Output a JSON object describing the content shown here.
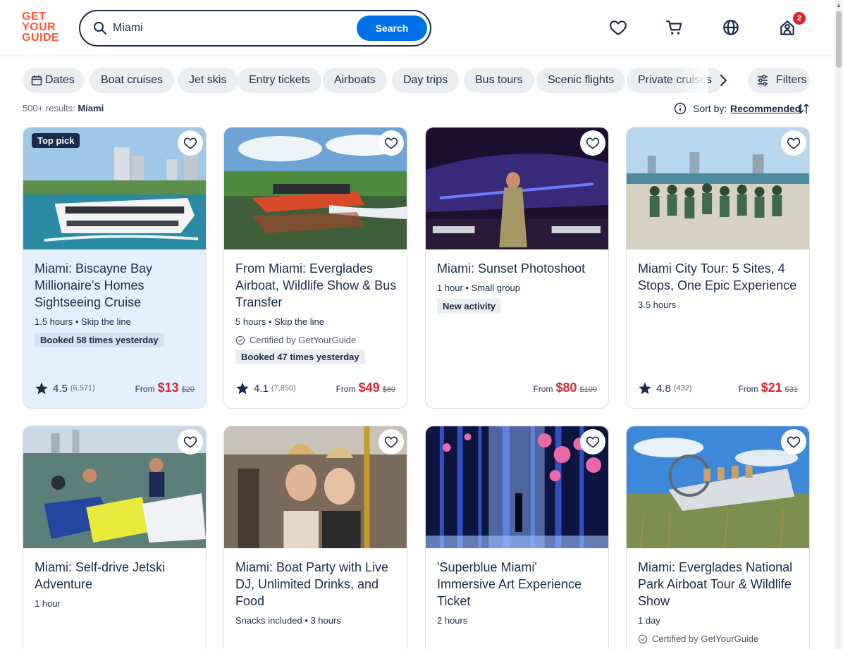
{
  "header": {
    "logo": [
      "GET",
      "YOUR",
      "GUIDE"
    ],
    "search_value": "Miami",
    "search_button": "Search",
    "cart_badge": "2",
    "icons": [
      "heart-icon",
      "cart-icon",
      "globe-icon",
      "profile-icon"
    ]
  },
  "filters": {
    "dates": "Dates",
    "chips": [
      "Boat cruises",
      "Jet skis",
      "Entry tickets",
      "Airboats",
      "Day trips",
      "Bus tours",
      "Scenic flights",
      "Private cruises"
    ],
    "filters_label": "Filters"
  },
  "results": {
    "count": "500+ results:",
    "query": "Miami",
    "sort_label": "Sort by:",
    "sort_value": "Recommended"
  },
  "cards": [
    {
      "badge": "Top pick",
      "title": "Miami: Biscayne Bay Millionaire's Homes Sightseeing Cruise",
      "meta": "1.5 hours • Skip the line",
      "tag": "Booked 58 times yesterday",
      "rating": "4.5",
      "reviews": "(6,571)",
      "from": "From",
      "price": "$13",
      "old_price": "$20"
    },
    {
      "title": "From Miami: Everglades Airboat, Wildlife Show & Bus Transfer",
      "meta": "5 hours • Skip the line",
      "certified": "Certified by GetYourGuide",
      "tag": "Booked 47 times yesterday",
      "rating": "4.1",
      "reviews": "(7,850)",
      "from": "From",
      "price": "$49",
      "old_price": "$60"
    },
    {
      "title": "Miami: Sunset Photoshoot",
      "meta": "1 hour • Small group",
      "tag": "New activity",
      "from": "From",
      "price": "$80",
      "old_price": "$100"
    },
    {
      "title": "Miami City Tour: 5 Sites, 4 Stops, One Epic Experience",
      "meta": "3.5 hours",
      "rating": "4.8",
      "reviews": "(432)",
      "from": "From",
      "price": "$21",
      "old_price": "$31"
    },
    {
      "title": "Miami: Self-drive Jetski Adventure",
      "meta": "1 hour"
    },
    {
      "title": "Miami: Boat Party with Live DJ, Unlimited Drinks, and Food",
      "meta": "Snacks included • 3 hours"
    },
    {
      "title": "'Superblue Miami' Immersive Art Experience Ticket",
      "meta": "2 hours"
    },
    {
      "title": "Miami: Everglades National Park Airboat Tour & Wildlife Show",
      "meta": "1 day",
      "certified": "Certified by GetYourGuide"
    }
  ],
  "colors": {
    "brand": "#ff5533",
    "search_button": "#0071eb",
    "price": "#d8262f",
    "text": "#1a2b49",
    "highlight_card": "#e4efff"
  }
}
